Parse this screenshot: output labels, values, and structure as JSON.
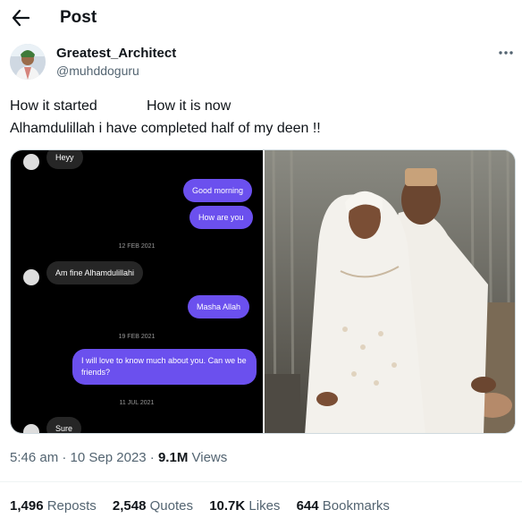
{
  "header": {
    "title": "Post"
  },
  "author": {
    "name": "Greatest_Architect",
    "handle": "@muhddoguru"
  },
  "post": {
    "line1_left": "How it started",
    "line1_right": "How it is now",
    "line2": "Alhamdulillah i have completed half of my deen !!"
  },
  "chat": {
    "messages": [
      {
        "dir": "in",
        "text": "Heyy"
      },
      {
        "dir": "out",
        "text": "Good morning"
      },
      {
        "dir": "out",
        "text": "How are you"
      },
      {
        "dir": "date",
        "text": "12 FEB 2021"
      },
      {
        "dir": "in",
        "text": "Am fine Alhamdulillahi"
      },
      {
        "dir": "out",
        "text": "Masha Allah"
      },
      {
        "dir": "date",
        "text": "19 FEB 2021"
      },
      {
        "dir": "out",
        "text": "I will love to know much about you.  Can we be friends?"
      },
      {
        "dir": "date",
        "text": "11 JUL 2021"
      },
      {
        "dir": "in",
        "text": "Sure"
      }
    ]
  },
  "meta": {
    "time": "5:46 am",
    "date": "10 Sep 2023",
    "views_count": "9.1M",
    "views_label": "Views"
  },
  "stats": {
    "reposts": {
      "count": "1,496",
      "label": "Reposts"
    },
    "quotes": {
      "count": "2,548",
      "label": "Quotes"
    },
    "likes": {
      "count": "10.7K",
      "label": "Likes"
    },
    "bookmarks": {
      "count": "644",
      "label": "Bookmarks"
    }
  }
}
